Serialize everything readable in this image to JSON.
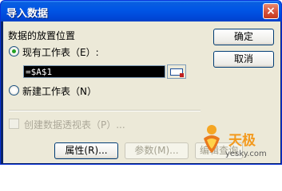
{
  "window": {
    "title": "导入数据",
    "close_symbol": "×"
  },
  "form": {
    "section_label": "数据的放置位置",
    "existing_sheet": {
      "label": "现有工作表（E）:",
      "checked": true
    },
    "reference_value": "=$A$1",
    "new_sheet": {
      "label": "新建工作表（N）",
      "checked": false
    },
    "pivot_checkbox": {
      "label": "创建数据透视表（P）...",
      "enabled": false
    }
  },
  "buttons": {
    "ok": "确定",
    "cancel": "取消",
    "properties": "属性(R)...",
    "parameters": "参数(M)...",
    "edit_query": "编辑查询"
  },
  "watermark": {
    "brand": "天极",
    "url": "yesky.com"
  },
  "colors": {
    "title_bar": "#0055e5",
    "dialog_bg": "#ece9d8",
    "radio_dot": "#21a121"
  }
}
